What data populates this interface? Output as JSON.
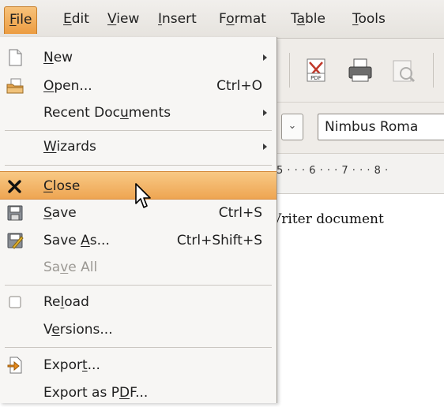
{
  "menubar": {
    "items": [
      {
        "pre": "",
        "u": "F",
        "post": "ile",
        "open": true
      },
      {
        "pre": "",
        "u": "E",
        "post": "dit"
      },
      {
        "pre": "",
        "u": "V",
        "post": "iew"
      },
      {
        "pre": "",
        "u": "I",
        "post": "nsert"
      },
      {
        "pre": "F",
        "u": "o",
        "post": "rmat"
      },
      {
        "pre": "T",
        "u": "a",
        "post": "ble"
      },
      {
        "pre": "",
        "u": "T",
        "post": "ools"
      }
    ]
  },
  "toolbar": {
    "pdf_label": "PDF"
  },
  "formatting": {
    "style_dropdown_glyph": "⌄",
    "font_name": "Nimbus Roma"
  },
  "ruler": {
    "text": "5 · · · 6 · · · 7 · · · 8 ·"
  },
  "document": {
    "visible_text": "Vriter document"
  },
  "file_menu": {
    "new": {
      "pre": "",
      "u": "N",
      "post": "ew",
      "icon": "new-document-icon"
    },
    "open": {
      "pre": "",
      "u": "O",
      "post": "pen...",
      "shortcut": "Ctrl+O",
      "icon": "open-folder-icon"
    },
    "recent": {
      "pre": "Recent Doc",
      "u": "u",
      "post": "ments"
    },
    "wizards": {
      "pre": "",
      "u": "W",
      "post": "izards"
    },
    "close": {
      "pre": "",
      "u": "C",
      "post": "lose",
      "icon": "close-x-icon"
    },
    "save": {
      "pre": "",
      "u": "S",
      "post": "ave",
      "shortcut": "Ctrl+S",
      "icon": "save-floppy-icon"
    },
    "save_as": {
      "pre": "Save ",
      "u": "A",
      "post": "s...",
      "shortcut": "Ctrl+Shift+S",
      "icon": "save-as-icon"
    },
    "save_all": {
      "pre": "Sa",
      "u": "v",
      "post": "e All"
    },
    "reload": {
      "pre": "Re",
      "u": "l",
      "post": "oad"
    },
    "versions": {
      "pre": "V",
      "u": "e",
      "post": "rsions..."
    },
    "export": {
      "pre": "Expor",
      "u": "t",
      "post": "...",
      "icon": "export-icon"
    },
    "export_pdf": {
      "pre": "Export as P",
      "u": "D",
      "post": "F..."
    }
  },
  "colors": {
    "highlight": "#eea552",
    "menu_bg": "#f7f6f4"
  }
}
